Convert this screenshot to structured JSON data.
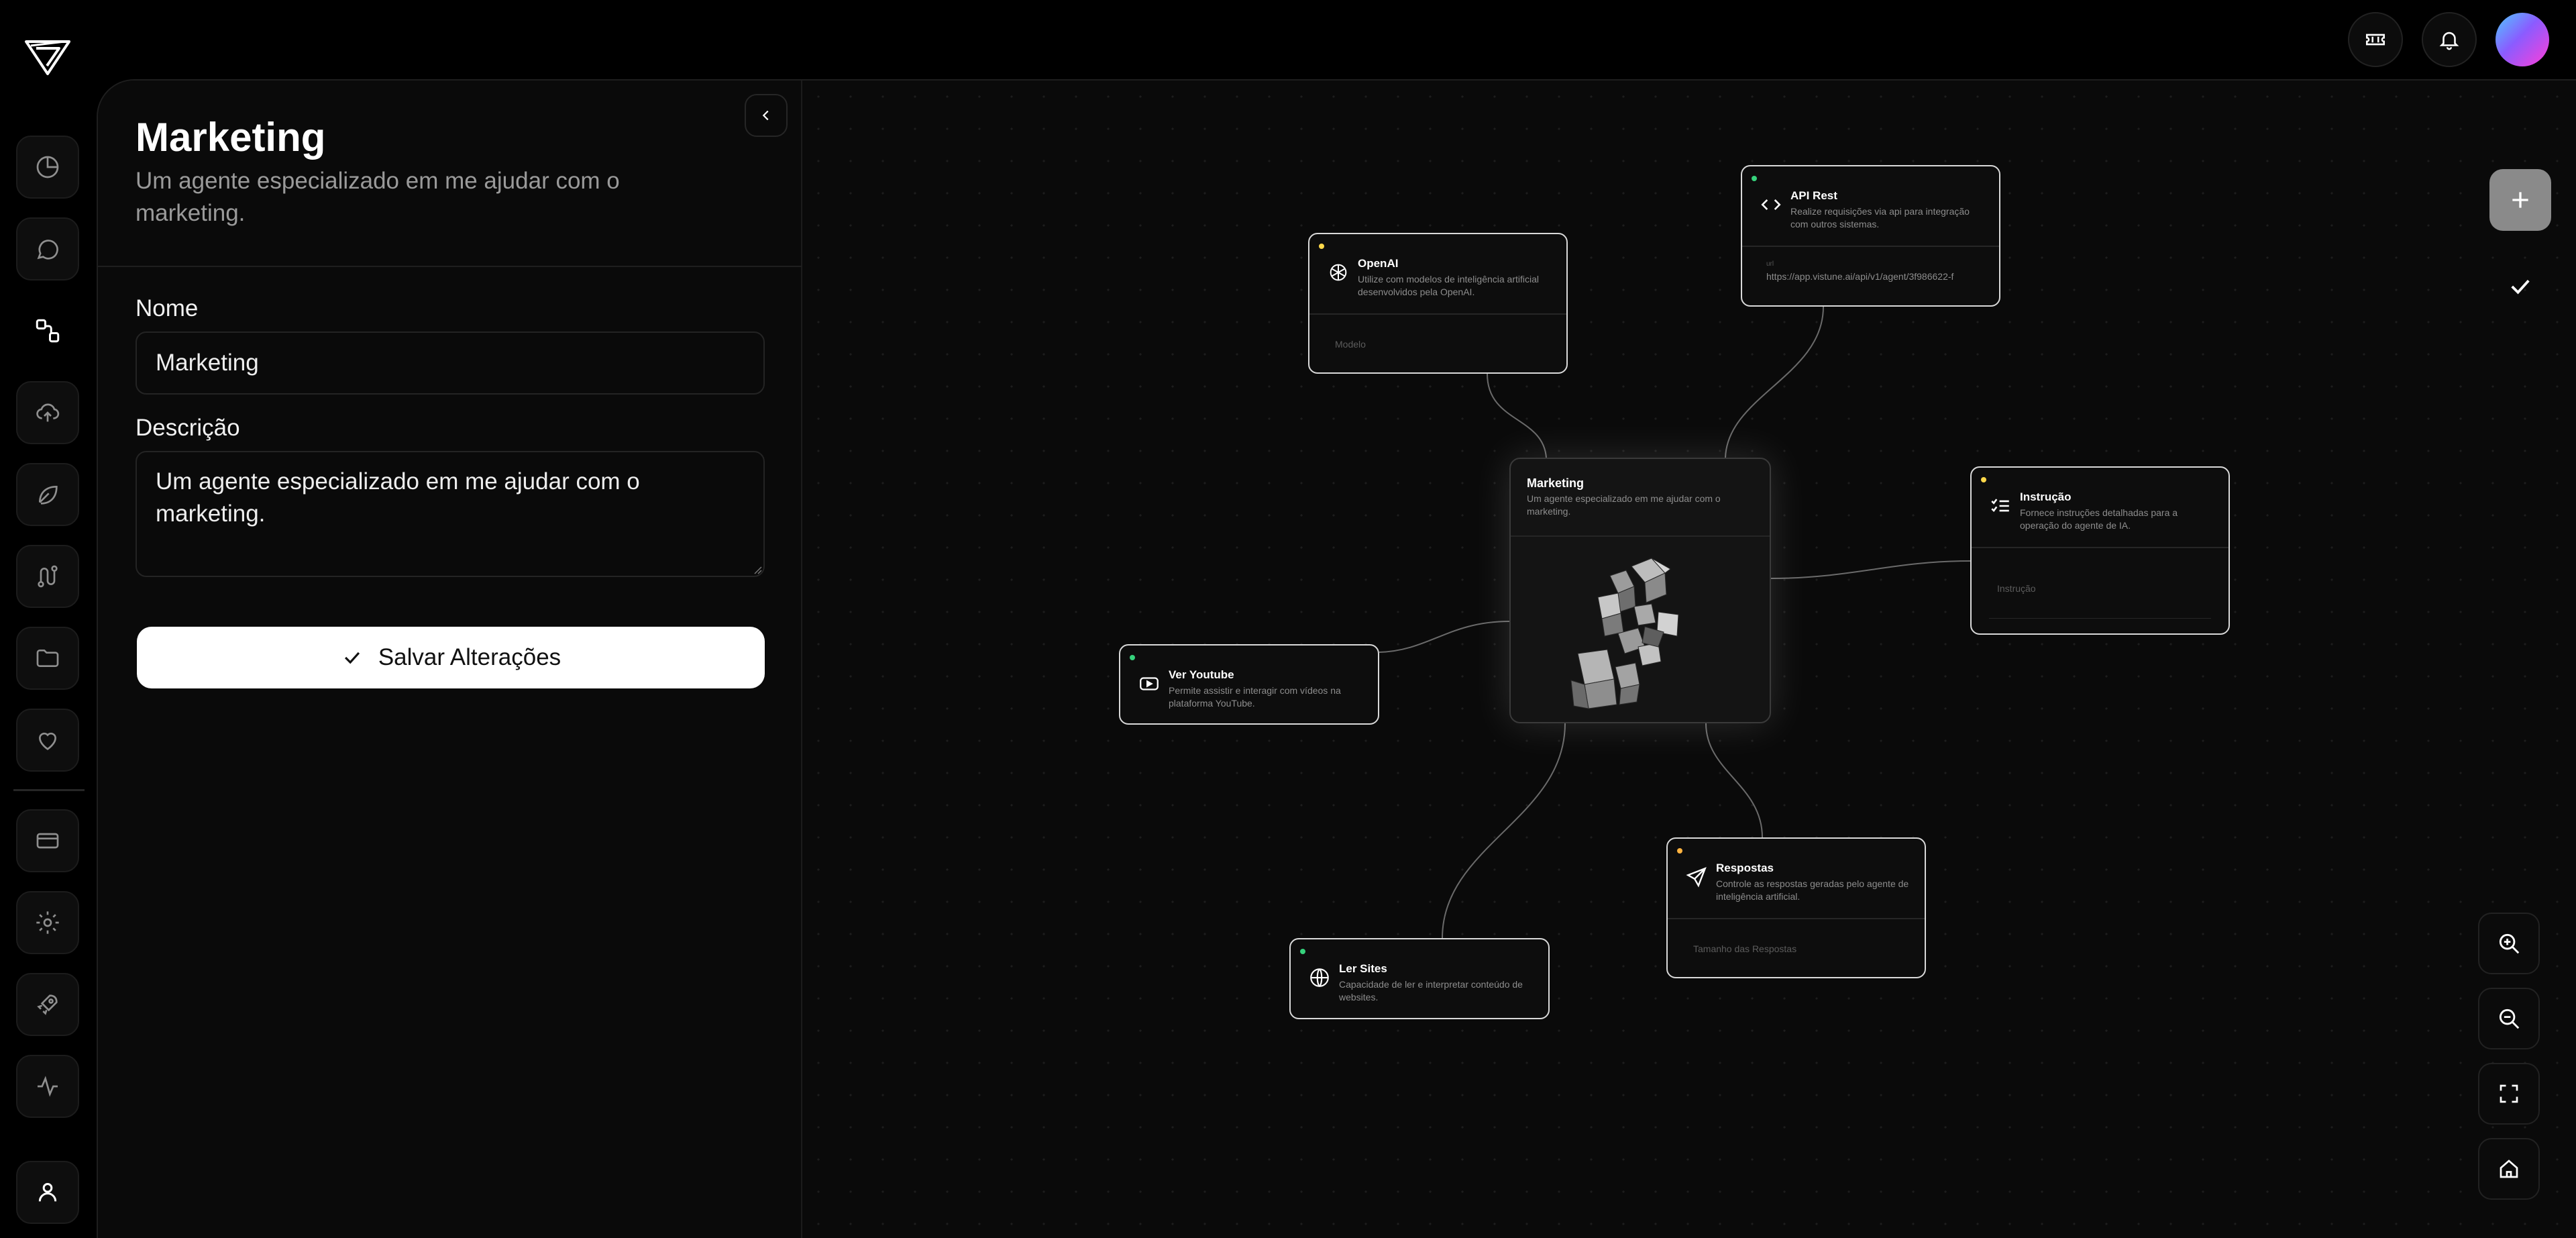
{
  "agent": {
    "title": "Marketing",
    "subtitle": "Um agente especializado em me ajudar com o marketing."
  },
  "form": {
    "name_label": "Nome",
    "name_value": "Marketing",
    "description_label": "Descrição",
    "description_value": "Um agente especializado em me ajudar com o marketing.",
    "save_label": "Salvar Alterações"
  },
  "nodes": {
    "center": {
      "title": "Marketing",
      "desc": "Um agente especializado em me ajudar com o marketing."
    },
    "openai": {
      "title": "OpenAI",
      "desc": "Utilize com modelos de inteligência artificial desenvolvidos pela OpenAI.",
      "field": "Modelo",
      "dot": "#ffd84a"
    },
    "api": {
      "title": "API Rest",
      "desc": "Realize requisições via api para integração com outros sistemas.",
      "url_label": "url",
      "url": "https://app.vistune.ai/api/v1/agent/3f986622-f",
      "dot": "#36d27c"
    },
    "instrucao": {
      "title": "Instrução",
      "desc": "Fornece instruções detalhadas para a operação do agente de IA.",
      "field": "Instrução",
      "dot": "#ffd84a"
    },
    "youtube": {
      "title": "Ver Youtube",
      "desc": "Permite assistir e interagir com vídeos na plataforma YouTube.",
      "dot": "#36d27c"
    },
    "respostas": {
      "title": "Respostas",
      "desc": "Controle as respostas geradas pelo agente de inteligência artificial.",
      "field": "Tamanho das Respostas",
      "dot": "#ffb340"
    },
    "sites": {
      "title": "Ler Sites",
      "desc": "Capacidade de ler e interpretar conteúdo de websites.",
      "dot": "#36d27c"
    }
  },
  "icons": {
    "logo": "logo-icon",
    "tickets": "ticket-icon",
    "notifications": "bell-icon",
    "rail": [
      "chart-pie-icon",
      "chat-icon",
      "flow-icon",
      "cloud-upload-icon",
      "leaf-icon",
      "route-icon",
      "folder-icon",
      "heart-icon",
      "credit-card-icon",
      "gear-icon",
      "rocket-icon",
      "activity-icon",
      "user-icon"
    ]
  }
}
